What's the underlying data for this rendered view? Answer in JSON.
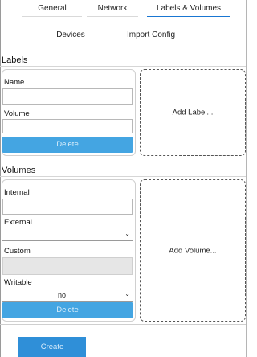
{
  "tabs": {
    "row1": [
      {
        "label": "General",
        "active": false
      },
      {
        "label": "Network",
        "active": false
      },
      {
        "label": "Labels & Volumes",
        "active": true
      }
    ],
    "row2": [
      {
        "label": "Devices",
        "active": false
      },
      {
        "label": "Import Config",
        "active": false
      }
    ]
  },
  "labels_section": {
    "title": "Labels",
    "name_label": "Name",
    "name_value": "",
    "volume_label": "Volume",
    "volume_value": "",
    "delete_label": "Delete",
    "add_label": "Add Label..."
  },
  "volumes_section": {
    "title": "Volumes",
    "internal_label": "Internal",
    "internal_value": "",
    "external_label": "External",
    "external_value": "",
    "custom_label": "Custom",
    "custom_value": "",
    "writable_label": "Writable",
    "writable_value": "no",
    "delete_label": "Delete",
    "add_label": "Add Volume..."
  },
  "footer": {
    "create_label": "Create"
  },
  "colors": {
    "accent_button": "#44a5e2",
    "primary_button": "#2f8fd8",
    "active_tab_underline": "#1976d2"
  }
}
